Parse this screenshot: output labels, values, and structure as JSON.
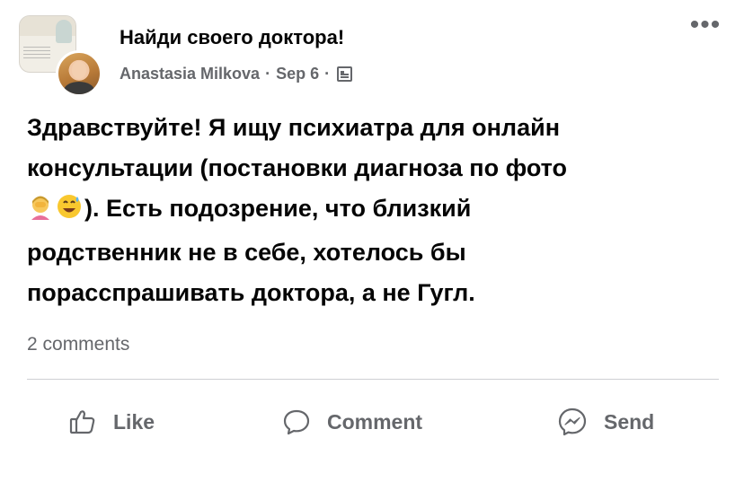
{
  "header": {
    "group_name": "Найди своего доктора!",
    "author": "Anastasia Milkova",
    "separator": "·",
    "date": "Sep 6",
    "audience_icon": "group-audience-icon",
    "more_icon": "more-options-icon",
    "more_glyph": "•••"
  },
  "post": {
    "lines": [
      "Здравствуйте! Я ищу психиатра для онлайн",
      "консультации (постановки диагноза по фото",
      "). Есть подозрение, что близкий",
      "родственник не в себе, хотелось бы",
      "порасспрашивать доктора, а не Гугл."
    ],
    "emojis": [
      "woman-facepalming-emoji",
      "grinning-sweat-emoji"
    ]
  },
  "footer": {
    "comments": "2 comments"
  },
  "actions": {
    "like_label": "Like",
    "comment_label": "Comment",
    "send_label": "Send"
  },
  "colors": {
    "text_primary": "#050505",
    "text_secondary": "#65676b",
    "divider": "#ced0d4",
    "background": "#ffffff"
  }
}
